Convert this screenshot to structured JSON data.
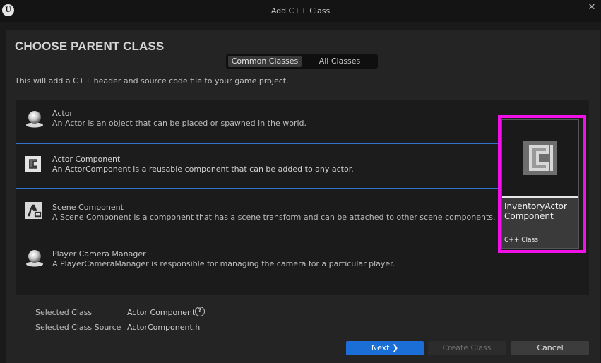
{
  "window": {
    "title": "Add C++ Class",
    "logo_text": "U",
    "close_glyph": "✕"
  },
  "page": {
    "heading": "CHOOSE PARENT CLASS",
    "description": "This will add a C++ header and source code file to your game project."
  },
  "tabs": [
    {
      "label": "Common Classes",
      "active": true
    },
    {
      "label": "All Classes",
      "active": false
    }
  ],
  "classes": [
    {
      "icon": "sphere-actor-icon",
      "title": "Actor",
      "description": "An Actor is an object that can be placed or spawned in the world.",
      "selected": false
    },
    {
      "icon": "actor-component-icon",
      "title": "Actor Component",
      "description": "An ActorComponent is a reusable component that can be added to any actor.",
      "selected": true
    },
    {
      "icon": "scene-component-icon",
      "title": "Scene Component",
      "description": "A Scene Component is a component that has a scene transform and can be attached to other scene components.",
      "selected": false
    },
    {
      "icon": "camera-manager-icon",
      "title": "Player Camera Manager",
      "description": "A PlayerCameraManager is responsible for managing the camera for a particular player.",
      "selected": false
    }
  ],
  "preview": {
    "icon": "cpp-class-icon",
    "name": "InventoryActor Component",
    "type": "C++ Class",
    "highlight_color": "#f010e8"
  },
  "selection": {
    "class_label": "Selected Class",
    "class_value": "Actor Component",
    "source_label": "Selected Class Source",
    "source_value": "ActorComponent.h",
    "help_glyph": "?"
  },
  "buttons": {
    "next": "Next ❯",
    "create": "Create Class",
    "cancel": "Cancel"
  },
  "colors": {
    "accent": "#1a6ed6",
    "selection_border": "#2f73cf",
    "highlight": "#f010e8"
  }
}
